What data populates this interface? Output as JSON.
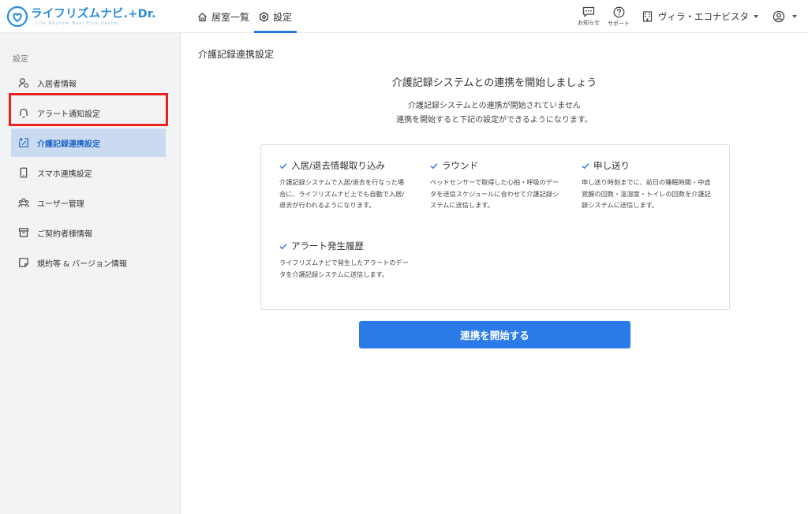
{
  "header": {
    "logo_text": "ライフリズムナビ.+Dr.",
    "logo_subtext": "Life Rhythm Navi Plus Doctor",
    "nav": [
      {
        "label": "居室一覧",
        "icon": "home-icon"
      },
      {
        "label": "設定",
        "icon": "gear-icon",
        "active": true
      }
    ],
    "notifications_label": "お知らせ",
    "support_label": "サポート",
    "facility_name": "ヴィラ・エコナビスタ"
  },
  "sidebar": {
    "title": "設定",
    "items": [
      {
        "label": "入居者情報",
        "icon": "resident-icon"
      },
      {
        "label": "アラート通知設定",
        "icon": "bell-icon"
      },
      {
        "label": "介護記録連携設定",
        "icon": "link-document-icon",
        "active": true
      },
      {
        "label": "スマホ連携設定",
        "icon": "smartphone-icon"
      },
      {
        "label": "ユーザー管理",
        "icon": "users-icon"
      },
      {
        "label": "ご契約者様情報",
        "icon": "archive-box-icon"
      },
      {
        "label": "規約等 & バージョン情報",
        "icon": "note-icon"
      }
    ]
  },
  "main": {
    "page_title": "介護記録連携設定",
    "headline": "介護記録システムとの連携を開始しましょう",
    "desc_line1": "介護記録システムとの連携が開始されていません",
    "desc_line2": "連携を開始すると下記の設定ができるようになります。",
    "features": [
      {
        "title": "入居/退去情報取り込み",
        "body": "介護記録システムで入居/退去を行なった場合に、ライフリズムナビ上でも自動で入居/退去が行われるようになります。"
      },
      {
        "title": "ラウンド",
        "body": "ベッドセンサーで取得した心拍・呼吸のデータを送信スケジュールに合わせて介護記録システムに送信します。"
      },
      {
        "title": "申し送り",
        "body": "申し送り時刻までに、前日の睡眠時間・中途覚醒の回数・温湿度・トイレの回数を介護記録システムに送信します。"
      },
      {
        "title": "アラート発生履歴",
        "body": "ライフリズムナビで発生したアラートのデータを介護記録システムに送信します。"
      }
    ],
    "start_button": "連携を開始する"
  },
  "colors": {
    "accent": "#2a7be8",
    "sidebar_active_bg": "#c9daf1",
    "highlight_border": "#e8221f"
  }
}
